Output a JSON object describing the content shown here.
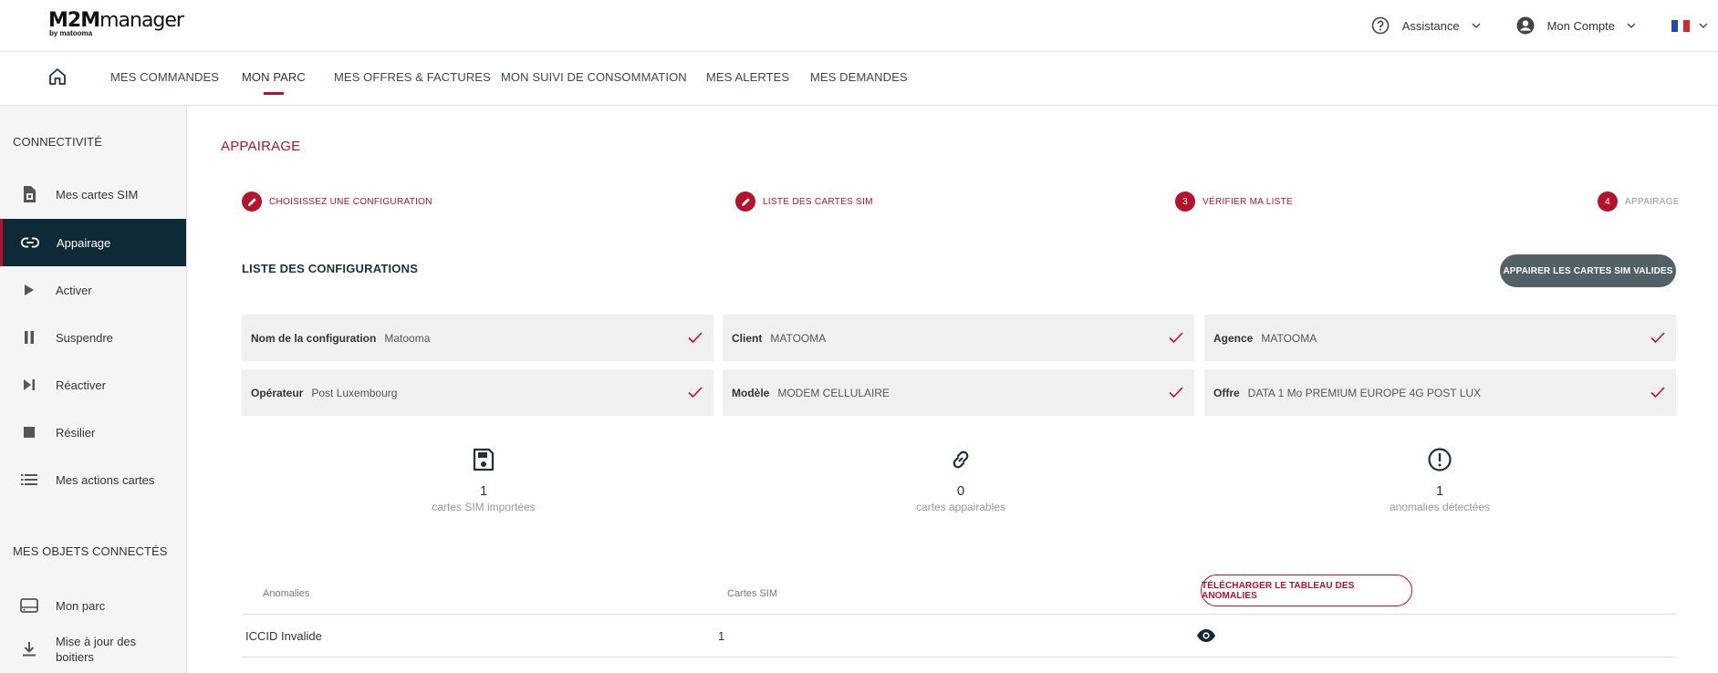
{
  "header": {
    "logo_main": "M2M",
    "logo_suffix": "manager",
    "logo_sub": "by matooma",
    "assistance": "Assistance",
    "account": "Mon Compte",
    "language_flag_colors": [
      "#1f4aa8",
      "#ffffff",
      "#d62828"
    ]
  },
  "nav": {
    "items": [
      "MES COMMANDES",
      "MON PARC",
      "MES OFFRES & FACTURES",
      "MON SUIVI DE CONSOMMATION",
      "MES ALERTES",
      "MES DEMANDES"
    ],
    "active": "MON PARC"
  },
  "sidebar": {
    "section1": "CONNECTIVITÉ",
    "items": [
      "Mes cartes SIM",
      "Appairage",
      "Activer",
      "Suspendre",
      "Réactiver",
      "Résilier",
      "Mes actions cartes"
    ],
    "active": "Appairage",
    "section2": "MES OBJETS CONNECTÉS",
    "items2": [
      "Mon parc",
      "Mise à jour des boitiers"
    ]
  },
  "page": {
    "title": "APPAIRAGE"
  },
  "stepper": [
    {
      "label": "CHOISISSEZ UNE CONFIGURATION",
      "marker": "pencil",
      "state": "done"
    },
    {
      "label": "LISTE DES CARTES SIM",
      "marker": "pencil",
      "state": "done"
    },
    {
      "label": "VÉRIFIER MA LISTE",
      "marker": "3",
      "state": "current"
    },
    {
      "label": "APPAIRAGE",
      "marker": "4",
      "state": "pending"
    }
  ],
  "configs": {
    "title": "LISTE DES CONFIGURATIONS",
    "pair_button": "APPAIRER LES CARTES SIM VALIDES",
    "items": [
      {
        "key": "Nom de la configuration",
        "value": "Matooma"
      },
      {
        "key": "Client",
        "value": "MATOOMA"
      },
      {
        "key": "Agence",
        "value": "MATOOMA"
      },
      {
        "key": "Opérateur",
        "value": "Post Luxembourg"
      },
      {
        "key": "Modèle",
        "value": "MODEM CELLULAIRE"
      },
      {
        "key": "Offre",
        "value": "DATA 1 Mo PREMIUM EUROPE 4G POST LUX"
      }
    ]
  },
  "stats": [
    {
      "icon": "save-icon",
      "value": "1",
      "caption": "cartes SIM importées"
    },
    {
      "icon": "link-icon",
      "value": "0",
      "caption": "cartes appairables"
    },
    {
      "icon": "alert-icon",
      "value": "1",
      "caption": "anomalies détectées"
    }
  ],
  "anomalies": {
    "col_anomalies": "Anomalies",
    "col_cards": "Cartes SIM",
    "download_button": "TÉLÉCHARGER LE TABLEAU DES ANOMALIES",
    "rows": [
      {
        "anomaly": "ICCID Invalide",
        "count": "1"
      }
    ]
  },
  "colors": {
    "accent": "#b5122b",
    "sidebar_active": "#0e2a36",
    "button_dark": "#526068"
  }
}
